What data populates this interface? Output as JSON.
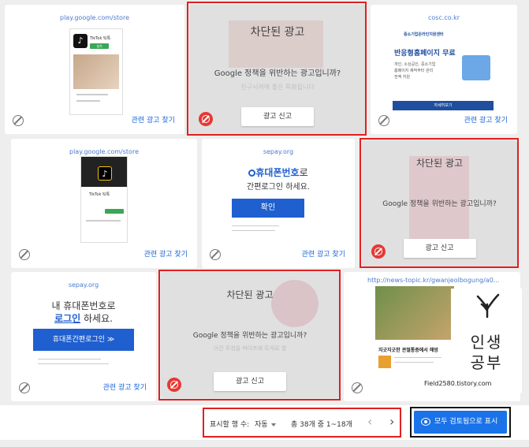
{
  "cards": [
    {
      "source": "play.google.com/store",
      "related": "관련 광고 찾기",
      "app_name": "TikTok 틱톡",
      "install": "설치"
    },
    {
      "source": "cosc.co.kr",
      "related": "관련 광고 찾기",
      "brand": "중소기업온라인지원센터",
      "headline": "반응형홈페이지 무료",
      "lines": [
        "개인, 소상공인, 중소기업",
        "홈페이지 제작부터 관리",
        "전액 지원"
      ],
      "cta": "자세히보기"
    },
    {
      "source": "play.google.com/store",
      "related": "관련 광고 찾기",
      "app_name": "TikTok 틱톡"
    },
    {
      "source": "sepay.org",
      "related": "관련 광고 찾기",
      "headline_a": "휴대폰번호",
      "headline_b": "로",
      "subline": "간편로그인 하세요.",
      "cta": "확인"
    },
    {
      "source": "sepay.org",
      "related": "관련 광고 찾기",
      "line1": "내 휴대폰번호로",
      "line2_a": "로그인",
      "line2_b": " 하세요.",
      "cta": "휴대폰간편로그인 ≫"
    },
    {
      "source": "http://news-topic.kr/gwanjeolbogung/a0...",
      "caption": "지긋지긋한 관절통증에서 해방"
    }
  ],
  "blocked": [
    {
      "title": "차단된 광고",
      "message": "Google 정책을 위반하는 광고입니까?",
      "report": "광고 신고",
      "ghost": "친구시켜에 좋은 특화됩니다"
    },
    {
      "title": "차단된 광고",
      "message": "Google 정책을 위반하는 광고입니까?",
      "report": "광고 신고"
    },
    {
      "title": "차단된 광고",
      "message": "Google 정책을 위반하는 광고입니까?",
      "report": "광고 신고",
      "ghost": "이건 주셨을 파이프에 트게로 할"
    }
  ],
  "pagination": {
    "rows_label": "표시할 행 수:",
    "rows_value": "자동",
    "range": "총 38개 중 1~18개",
    "prev": "‹",
    "next": "›"
  },
  "show_all": "모두 검토됨으로 표시",
  "watermark": {
    "line1": "인생",
    "line2": "공부",
    "url": "Field2580.tistory.com"
  },
  "colors": {
    "accent": "#1a73e8",
    "highlight": "#e02020",
    "blocked_bg": "#e0e0e0",
    "danger": "#e53935"
  }
}
